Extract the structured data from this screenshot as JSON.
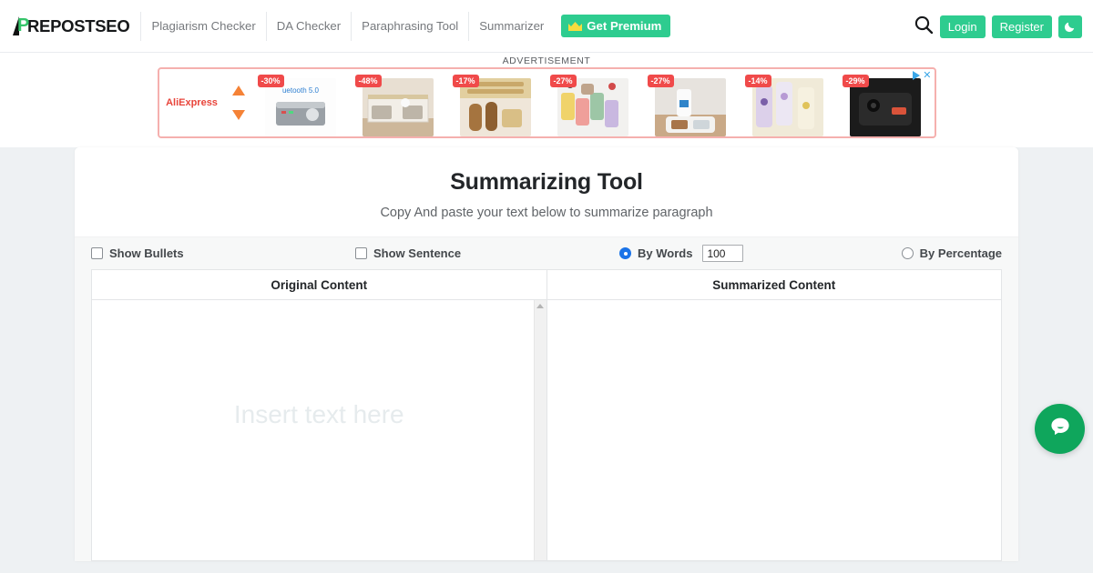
{
  "header": {
    "logo_text": "REPOSTSEO",
    "logo_mark": "P",
    "nav": [
      {
        "label": "Plagiarism Checker",
        "name": "nav-plagiarism-checker"
      },
      {
        "label": "DA Checker",
        "name": "nav-da-checker"
      },
      {
        "label": "Paraphrasing Tool",
        "name": "nav-paraphrasing-tool"
      },
      {
        "label": "Summarizer",
        "name": "nav-summarizer"
      }
    ],
    "premium_label": "Get Premium",
    "login_label": "Login",
    "register_label": "Register",
    "search_icon": "search-icon",
    "dark_mode_icon": "moon-icon",
    "accent_color": "#2ecc8f"
  },
  "ad": {
    "label": "ADVERTISEMENT",
    "brand": "AliExpress",
    "close_label": "✕",
    "items": [
      {
        "badge": "-30%",
        "alt": "bluetooth-amplifier"
      },
      {
        "badge": "-48%",
        "alt": "cat-house"
      },
      {
        "badge": "-17%",
        "alt": "baking-rollers"
      },
      {
        "badge": "-27%",
        "alt": "phone-cases-colored"
      },
      {
        "badge": "-27%",
        "alt": "pet-feeder"
      },
      {
        "badge": "-14%",
        "alt": "floral-phone-cases"
      },
      {
        "badge": "-29%",
        "alt": "black-camera-case"
      }
    ]
  },
  "main": {
    "title": "Summarizing Tool",
    "subtitle": "Copy And paste your text below to summarize paragraph",
    "options": {
      "show_bullets": "Show Bullets",
      "show_sentence": "Show Sentence",
      "by_words": "By Words",
      "words_value": "100",
      "by_percentage": "By Percentage"
    },
    "panels": {
      "original_title": "Original Content",
      "summarized_title": "Summarized Content",
      "original_placeholder": "Insert text here",
      "summarized_placeholder": ""
    }
  },
  "chat": {
    "icon": "chat-bubble-icon",
    "color": "#0fa65c"
  }
}
